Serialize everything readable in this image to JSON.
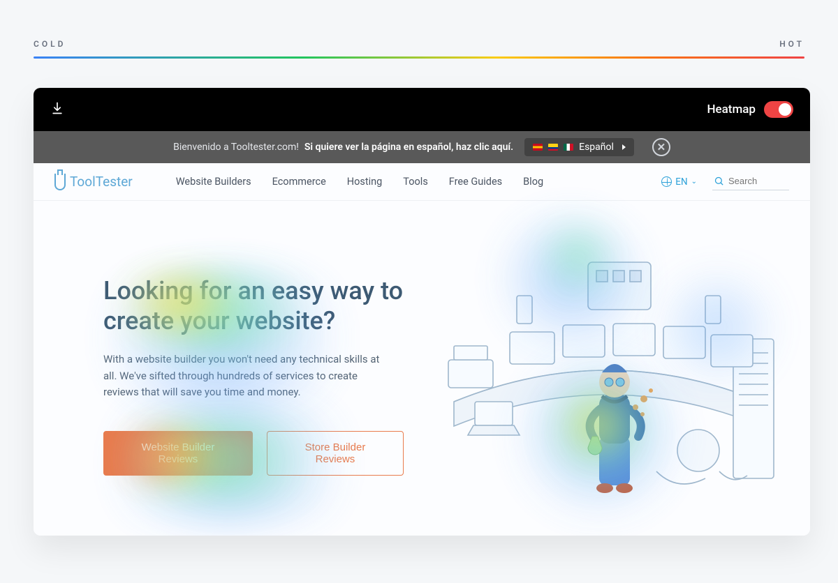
{
  "legend": {
    "cold": "COLD",
    "hot": "HOT"
  },
  "topbar": {
    "heatmap_label": "Heatmap"
  },
  "banner": {
    "text_plain": "Bienvenido a Tooltester.com! ",
    "text_bold": "Si quiere ver la página en español, haz clic aquí.",
    "lang_name": "Español"
  },
  "logo": {
    "brand_a": "Tool",
    "brand_b": "Tester"
  },
  "nav": {
    "items": [
      {
        "label": "Website Builders"
      },
      {
        "label": "Ecommerce"
      },
      {
        "label": "Hosting"
      },
      {
        "label": "Tools"
      },
      {
        "label": "Free Guides"
      },
      {
        "label": "Blog"
      }
    ],
    "lang_short": "EN",
    "search_placeholder": "Search"
  },
  "hero": {
    "headline": "Looking for an easy way to create your website?",
    "tagline": "With a website builder you won't need any technical skills at all. We've sifted through hundreds of services to create reviews that will save you time and money.",
    "cta_primary": "Website Builder Reviews",
    "cta_secondary": "Store Builder Reviews"
  }
}
